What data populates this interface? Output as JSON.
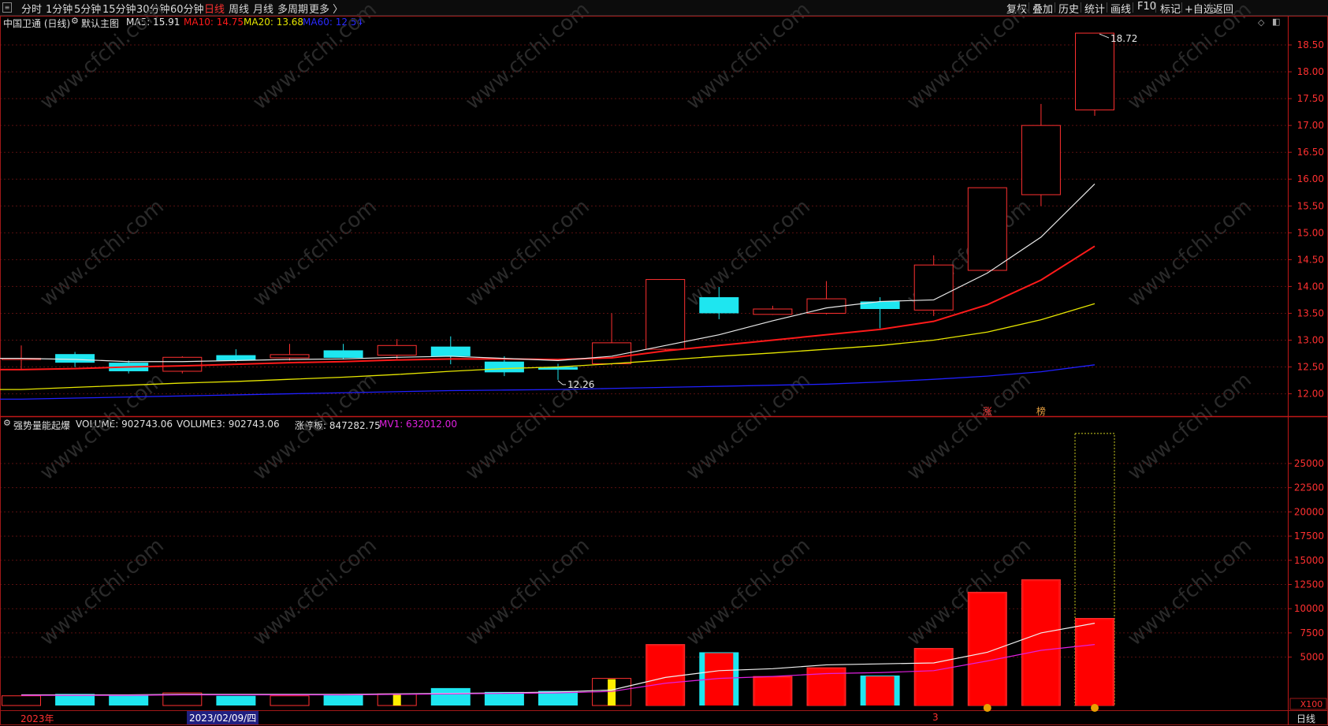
{
  "tabs": {
    "fen_shi": "分时",
    "min1": "1分钟",
    "min5": "5分钟",
    "min15": "15分钟",
    "min30": "30分钟",
    "min60": "60分钟",
    "day": "日线",
    "week": "周线",
    "month": "月线",
    "multi": "多周期",
    "more": "更多 〉"
  },
  "right_toolbar": {
    "fuquan": "复权",
    "diejia": "叠加",
    "lishi": "历史",
    "tongji": "统计",
    "huaxian": "画线",
    "f10": "F10",
    "biaoji": "标记",
    "add_watch": "+自选",
    "back": "返回"
  },
  "main_header": {
    "stock": "中国卫通 (日线)",
    "indicator": "默认主图",
    "ma5": "MA5: 15.91",
    "ma10": "MA10: 14.75",
    "ma20": "MA20: 13.68",
    "ma60": "MA60: 12.54"
  },
  "volume_header": {
    "title": "强势量能起爆",
    "volume": "VOLUME: 902743.06",
    "volume3": "VOLUME3: 902743.06",
    "zhangting": "涨停板: 847282.75",
    "mv1": "MV1: 632012.00"
  },
  "price_axis_labels": [
    "18.50",
    "18.00",
    "17.50",
    "17.00",
    "16.50",
    "16.00",
    "15.50",
    "15.00",
    "14.50",
    "14.00",
    "13.50",
    "13.00",
    "12.50",
    "12.00"
  ],
  "volume_axis_labels": [
    "25000",
    "22500",
    "20000",
    "17500",
    "15000",
    "12500",
    "10000",
    "7500",
    "5000"
  ],
  "volume_unit": "X100",
  "annotations": {
    "high": "18.72",
    "low": "12.26",
    "marker_zhang": "涨",
    "marker_bang": "榜"
  },
  "bottom": {
    "year": "2023年",
    "cursor_date": "2023/02/09/四",
    "month_mark": "3",
    "period": "日线"
  },
  "watermark": "www.cfchi.com",
  "colors": {
    "up": "#ff2020",
    "down": "#1ee6f0",
    "ma5": "#e8e8e8",
    "ma10": "#ff1a1a",
    "ma20": "#e6e600",
    "ma60": "#2020ff",
    "mv1": "#e020e0"
  },
  "chart_data": {
    "type": "candlestick",
    "price_ylim": [
      11.7,
      18.75
    ],
    "candles": [
      {
        "o": 12.65,
        "c": 12.66,
        "h": 12.9,
        "l": 12.45
      },
      {
        "o": 12.74,
        "c": 12.58,
        "h": 12.78,
        "l": 12.5
      },
      {
        "o": 12.58,
        "c": 12.42,
        "h": 12.62,
        "l": 12.38
      },
      {
        "o": 12.42,
        "c": 12.68,
        "h": 12.7,
        "l": 12.38
      },
      {
        "o": 12.72,
        "c": 12.62,
        "h": 12.83,
        "l": 12.6
      },
      {
        "o": 12.67,
        "c": 12.73,
        "h": 12.93,
        "l": 12.62
      },
      {
        "o": 12.81,
        "c": 12.67,
        "h": 12.93,
        "l": 12.64
      },
      {
        "o": 12.72,
        "c": 12.9,
        "h": 13.02,
        "l": 12.65
      },
      {
        "o": 12.88,
        "c": 12.7,
        "h": 13.07,
        "l": 12.55
      },
      {
        "o": 12.6,
        "c": 12.4,
        "h": 12.7,
        "l": 12.33
      },
      {
        "o": 12.5,
        "c": 12.45,
        "h": 12.56,
        "l": 12.26
      },
      {
        "o": 12.56,
        "c": 12.95,
        "h": 13.5,
        "l": 12.53
      },
      {
        "o": 12.83,
        "c": 14.13,
        "h": 14.13,
        "l": 12.8
      },
      {
        "o": 13.8,
        "c": 13.5,
        "h": 13.99,
        "l": 13.39
      },
      {
        "o": 13.48,
        "c": 13.58,
        "h": 13.64,
        "l": 13.47
      },
      {
        "o": 13.5,
        "c": 13.77,
        "h": 14.1,
        "l": 13.48
      },
      {
        "o": 13.72,
        "c": 13.58,
        "h": 13.8,
        "l": 13.22
      },
      {
        "o": 13.56,
        "c": 14.4,
        "h": 14.58,
        "l": 13.45
      },
      {
        "o": 14.3,
        "c": 15.84,
        "h": 15.84,
        "l": 14.28
      },
      {
        "o": 15.71,
        "c": 17.0,
        "h": 17.4,
        "l": 15.5
      },
      {
        "o": 17.29,
        "c": 18.72,
        "h": 18.72,
        "l": 17.18
      }
    ],
    "ma5": [
      12.66,
      12.64,
      12.6,
      12.6,
      12.62,
      12.64,
      12.65,
      12.68,
      12.7,
      12.66,
      12.62,
      12.7,
      12.9,
      13.1,
      13.36,
      13.6,
      13.72,
      13.75,
      14.25,
      14.92,
      15.91
    ],
    "ma10": [
      12.45,
      12.47,
      12.5,
      12.52,
      12.55,
      12.58,
      12.6,
      12.63,
      12.65,
      12.65,
      12.64,
      12.67,
      12.8,
      12.9,
      13.0,
      13.1,
      13.2,
      13.35,
      13.66,
      14.12,
      14.75
    ],
    "ma20": [
      12.08,
      12.12,
      12.16,
      12.2,
      12.23,
      12.27,
      12.31,
      12.36,
      12.42,
      12.47,
      12.5,
      12.56,
      12.63,
      12.7,
      12.76,
      12.83,
      12.9,
      13.0,
      13.15,
      13.38,
      13.68
    ],
    "ma60": [
      11.9,
      11.92,
      11.94,
      11.96,
      11.98,
      12.0,
      12.02,
      12.04,
      12.06,
      12.07,
      12.08,
      12.1,
      12.12,
      12.14,
      12.16,
      12.18,
      12.22,
      12.27,
      12.33,
      12.41,
      12.54
    ],
    "volume_ylim": [
      0,
      28500
    ],
    "volume": [
      1000,
      1200,
      1100,
      1300,
      1000,
      1000,
      1100,
      1200,
      1800,
      1400,
      1500,
      2800,
      6300,
      5500,
      3000,
      3900,
      3100,
      5900,
      11700,
      13000,
      9000
    ],
    "volume_extra": {
      "index": 20,
      "value": 28100
    },
    "volume_ma": [
      1100,
      1100,
      1100,
      1150,
      1150,
      1150,
      1150,
      1200,
      1250,
      1300,
      1400,
      1600,
      2900,
      3600,
      3800,
      4200,
      4300,
      4400,
      5500,
      7500,
      8500
    ],
    "mv1": [
      1050,
      1050,
      1050,
      1100,
      1100,
      1100,
      1100,
      1150,
      1200,
      1250,
      1300,
      1450,
      2300,
      2800,
      3000,
      3300,
      3400,
      3600,
      4600,
      5700,
      6300
    ],
    "volume_candle_colors": [
      "up",
      "down",
      "down",
      "up",
      "down",
      "up",
      "down",
      "special",
      "down",
      "down",
      "down",
      "special",
      "up",
      "down_fill",
      "up",
      "up",
      "down_fill",
      "up",
      "up",
      "up",
      "up"
    ]
  }
}
